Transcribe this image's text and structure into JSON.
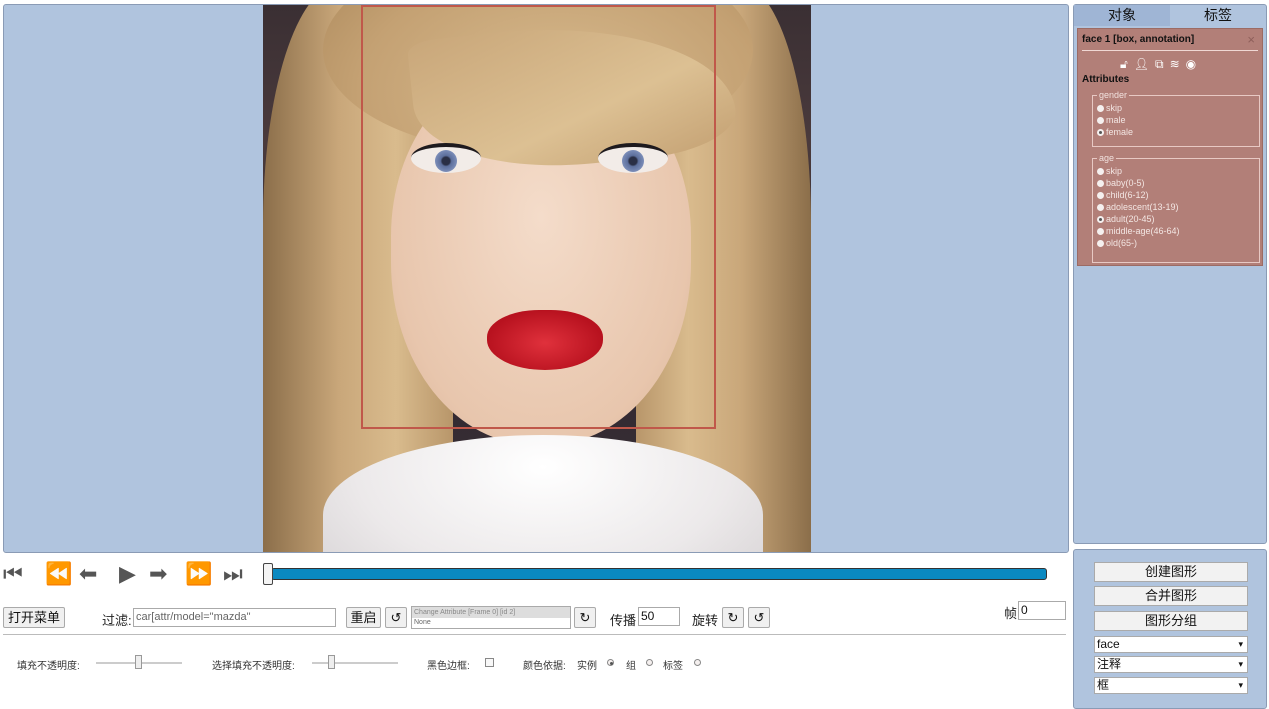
{
  "right_panel": {
    "tabs": [
      "对象",
      "标签"
    ],
    "object": {
      "title": "face 1 [box, annotation]",
      "close": "×",
      "attributes_label": "Attributes",
      "groups": [
        {
          "name": "gender",
          "options": [
            "skip",
            "male",
            "female"
          ],
          "selected": "female"
        },
        {
          "name": "age",
          "options": [
            "skip",
            "baby(0-5)",
            "child(6-12)",
            "adolescent(13-19)",
            "adult(20-45)",
            "middle-age(46-64)",
            "old(65-)"
          ],
          "selected": "adult(20-45)"
        }
      ]
    }
  },
  "player": {
    "buttons": [
      "⏮",
      "⏪",
      "◀",
      "▶",
      "▶",
      "⏩",
      "⏭"
    ],
    "progress": 0
  },
  "toolbar": {
    "open_menu": "打开菜单",
    "filter_label": "过滤:",
    "filter_value": "car[attr/model=\"mazda\"",
    "reset": "重启",
    "undo_icon": "↺",
    "state_line1": "Change Attribute [Frame 0] [id 2]",
    "state_line2": "None",
    "redo_icon": "↻",
    "propagate_label": "传播",
    "propagate_value": "50",
    "rotate_label": "旋转",
    "frame_label": "帧",
    "frame_value": "0"
  },
  "settings": {
    "fill_opacity": "填充不透明度:",
    "select_fill_opacity": "选择填充不透明度:",
    "black_border": "黑色边框:",
    "color_by": "颜色依据:",
    "color_by_options": [
      "实例",
      "组",
      "标签"
    ]
  },
  "tools": {
    "create_shape": "创建图形",
    "merge_shapes": "合并图形",
    "group_shapes": "图形分组",
    "label_select": "face",
    "mode_select": "注释",
    "shape_select": "框"
  },
  "colors": {
    "canvas_bg": "#b0c4de",
    "bbox": "#c0584a",
    "card": "#b27f78",
    "progress": "#0a89c1"
  }
}
